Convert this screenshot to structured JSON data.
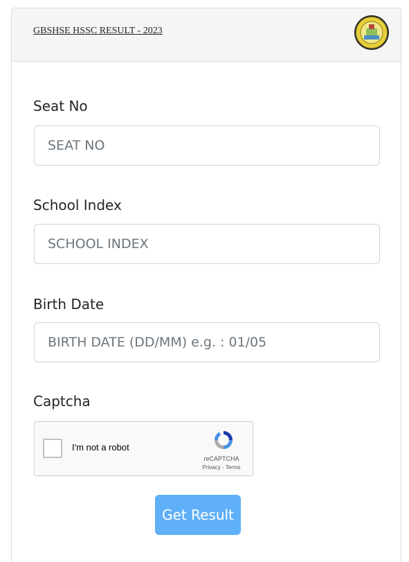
{
  "header": {
    "title": "GBSHSE HSSC RESULT - 2023",
    "logo_icon": "gbshse-seal-icon"
  },
  "form": {
    "seat_no": {
      "label": "Seat No",
      "placeholder": "SEAT NO",
      "value": ""
    },
    "school_index": {
      "label": "School Index",
      "placeholder": "SCHOOL INDEX",
      "value": ""
    },
    "birth_date": {
      "label": "Birth Date",
      "placeholder": "BIRTH DATE (DD/MM) e.g. : 01/05",
      "value": ""
    },
    "captcha": {
      "label": "Captcha",
      "checkbox_label": "I'm not a robot",
      "brand": "reCAPTCHA",
      "links": "Privacy - Terms",
      "checked": false
    },
    "submit_label": "Get Result"
  },
  "colors": {
    "header_bg": "#f5f5f5",
    "button_bg": "#5fb0f8",
    "border": "#ced4da"
  }
}
